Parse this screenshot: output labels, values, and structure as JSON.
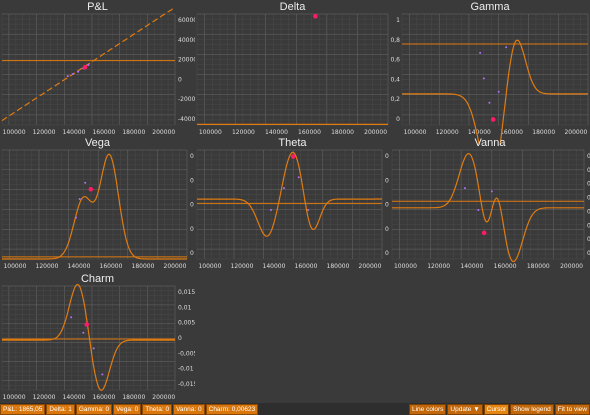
{
  "colors": {
    "curve": "#e07b10",
    "marker": "#ff1a6a",
    "dots": "#b070ff",
    "panel_bg": "#3a3a3a"
  },
  "panels": [
    {
      "id": "pl",
      "title": "P&L",
      "y_side": "right",
      "xticks": [
        "100000",
        "120000",
        "140000",
        "160000",
        "180000",
        "200000"
      ],
      "yticks": [
        "60000",
        "40000",
        "20000",
        "0",
        "-20000",
        "-40000"
      ]
    },
    {
      "id": "delta",
      "title": "Delta",
      "y_side": "left",
      "xticks": [
        "100000",
        "120000",
        "140000",
        "160000",
        "180000",
        "200000"
      ],
      "yticks": []
    },
    {
      "id": "gamma",
      "title": "Gamma",
      "y_side": "left",
      "xticks": [
        "100000",
        "120000",
        "140000",
        "160000",
        "180000",
        "200000"
      ],
      "yticks": [
        "1",
        "0,8",
        "0,6",
        "0,4",
        "0,2",
        "0"
      ]
    },
    {
      "id": "vega",
      "title": "Vega",
      "y_side": "right",
      "xticks": [
        "100000",
        "120000",
        "140000",
        "160000",
        "180000",
        "200000"
      ],
      "yticks": [
        "0",
        "0",
        "0",
        "0",
        "0"
      ]
    },
    {
      "id": "theta",
      "title": "Theta",
      "y_side": "right",
      "xticks": [
        "100000",
        "120000",
        "140000",
        "160000",
        "180000",
        "200000"
      ],
      "yticks": [
        "0",
        "0",
        "0",
        "0",
        "0"
      ]
    },
    {
      "id": "vanna",
      "title": "Vanna",
      "y_side": "right",
      "xticks": [
        "100000",
        "120000",
        "140000",
        "160000",
        "180000",
        "200000"
      ],
      "yticks": [
        "0",
        "0",
        "0",
        "0",
        "0",
        "0",
        "0",
        "0"
      ]
    },
    {
      "id": "charm",
      "title": "Charm",
      "y_side": "right",
      "xticks": [
        "100000",
        "120000",
        "140000",
        "160000",
        "180000",
        "200000"
      ],
      "yticks": [
        "0,015",
        "0,01",
        "0,005",
        "0",
        "-0,005",
        "-0,01",
        "-0,015"
      ]
    }
  ],
  "status": {
    "pl": "P&L: 1865,05",
    "delta": "Delta: 1",
    "gamma": "Gamma: 0",
    "vega": "Vega: 0",
    "theta": "Theta: 0",
    "vanna": "Vanna: 0",
    "charm": "Charm: 0,00623"
  },
  "buttons": {
    "line_colors": "Line colors",
    "update": "Update",
    "update_arrow": "▼",
    "cursor": "Cursor",
    "show_legend": "Show legend",
    "fit_to_view": "Fit to view"
  }
}
